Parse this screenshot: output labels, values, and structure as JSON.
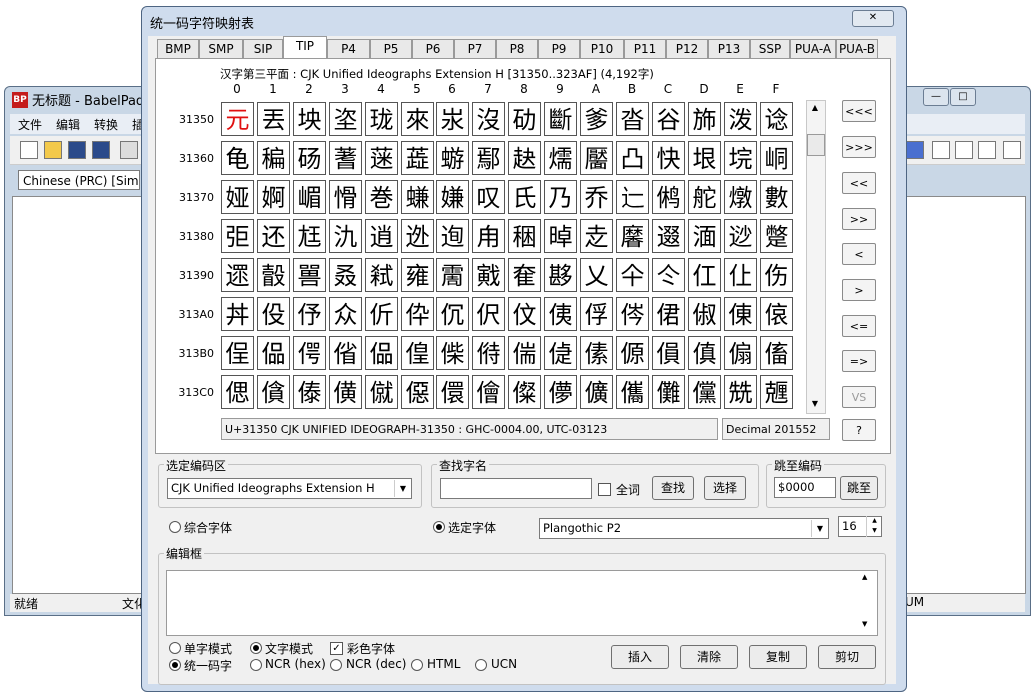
{
  "background_window": {
    "title": "无标题 - BabelPad",
    "menu": [
      "文件",
      "编辑",
      "转换",
      "插"
    ],
    "language_combo": "Chinese (PRC) [Simp",
    "status_left": "就绪",
    "status_mid": "文化",
    "status_right": "UM",
    "app_icon_text": "BP"
  },
  "dialog": {
    "title": "统一码字符映射表",
    "close_label": "✕",
    "tabs": [
      "BMP",
      "SMP",
      "SIP",
      "TIP",
      "P4",
      "P5",
      "P6",
      "P7",
      "P8",
      "P9",
      "P10",
      "P11",
      "P12",
      "P13",
      "SSP",
      "PUA-A",
      "PUA-B"
    ],
    "active_tab": "TIP",
    "block_caption": "汉字第三平面 : CJK Unified Ideographs Extension H [31350..323AF] (4,192字)",
    "column_headers": [
      "0",
      "1",
      "2",
      "3",
      "4",
      "5",
      "6",
      "7",
      "8",
      "9",
      "A",
      "B",
      "C",
      "D",
      "E",
      "F"
    ],
    "rows": [
      {
        "label": "31350",
        "chars": [
          "元",
          "丟",
          "坱",
          "垐",
          "珑",
          "來",
          "汖",
          "沒",
          "劯",
          "斷",
          "爹",
          "沓",
          "谷",
          "斾",
          "泼",
          "谂"
        ]
      },
      {
        "label": "31360",
        "chars": [
          "龟",
          "稨",
          "砀",
          "蓍",
          "蒾",
          "蕋",
          "蝣",
          "鄢",
          "赽",
          "燸",
          "靨",
          "凸",
          "快",
          "垠",
          "垸",
          "峒"
        ]
      },
      {
        "label": "31370",
        "chars": [
          "娅",
          "婀",
          "嵋",
          "愲",
          "巻",
          "螊",
          "嫌",
          "叹",
          "氏",
          "乃",
          "乔",
          "辷",
          "鸺",
          "舵",
          "燉",
          "數"
        ]
      },
      {
        "label": "31380",
        "chars": [
          "弡",
          "还",
          "尪",
          "氿",
          "逍",
          "迯",
          "迿",
          "甪",
          "稇",
          "晫",
          "赱",
          "黁",
          "逫",
          "湎",
          "逤",
          "蹩"
        ]
      },
      {
        "label": "31390",
        "chars": [
          "遝",
          "瞉",
          "嘼",
          "叒",
          "弒",
          "雍",
          "霌",
          "戭",
          "奞",
          "夦",
          "乂",
          "仐",
          "仒",
          "仜",
          "仩",
          "伤"
        ]
      },
      {
        "label": "313A0",
        "chars": [
          "丼",
          "伇",
          "伃",
          "众",
          "伒",
          "伜",
          "伔",
          "伬",
          "伩",
          "侇",
          "俘",
          "侺",
          "侰",
          "俶",
          "倲",
          "偯"
        ]
      },
      {
        "label": "313B0",
        "chars": [
          "侱",
          "偘",
          "偔",
          "偗",
          "偘",
          "偟",
          "偨",
          "偫",
          "偳",
          "偼",
          "傃",
          "傆",
          "傊",
          "傎",
          "傓",
          "傗"
        ]
      },
      {
        "label": "313C0",
        "chars": [
          "偲",
          "僋",
          "傣",
          "僙",
          "僦",
          "僫",
          "儇",
          "儈",
          "儏",
          "儚",
          "儣",
          "儶",
          "儺",
          "儻",
          "兟",
          "兣"
        ]
      }
    ],
    "selected_char": "元",
    "nav_buttons": [
      "<<<",
      ">>>",
      "<<",
      ">>",
      "<",
      ">",
      "<=",
      "=>",
      "VS",
      "?"
    ],
    "info_text": "U+31350 CJK UNIFIED IDEOGRAPH-31350 : GHC-0004.00, UTC-03123",
    "decimal_text": "Decimal 201552",
    "select_block": {
      "label": "选定编码区",
      "value": "CJK Unified Ideographs Extension H"
    },
    "find_name": {
      "label": "查找字名",
      "value": "",
      "whole_word_label": "全词",
      "find_button": "查找",
      "select_button": "选择"
    },
    "jump": {
      "label": "跳至编码",
      "value": "$0000",
      "button": "跳至"
    },
    "font": {
      "composite_label": "综合字体",
      "selected_label": "选定字体",
      "font_value": "Plangothic P2",
      "size_value": "16"
    },
    "edit_box": {
      "label": "编辑框",
      "value": ""
    },
    "mode_options": {
      "single_char": "单字模式",
      "text_mode": "文字模式",
      "color_font": "彩色字体",
      "unicode": "统一码字",
      "ncr_hex": "NCR (hex)",
      "ncr_dec": "NCR (dec)",
      "html": "HTML",
      "ucn": "UCN"
    },
    "action_buttons": {
      "insert": "插入",
      "clear": "清除",
      "copy": "复制",
      "cut": "剪切"
    }
  }
}
